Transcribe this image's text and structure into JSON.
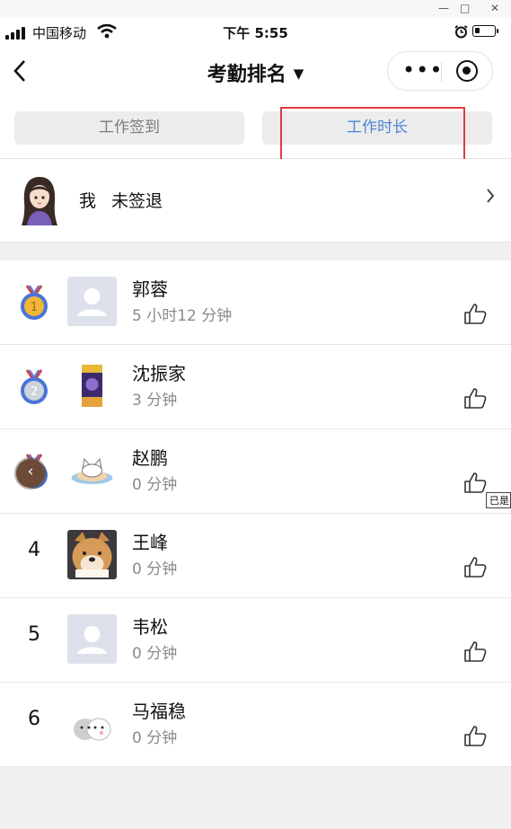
{
  "status_bar": {
    "carrier": "中国移动",
    "time": "下午 5:55"
  },
  "nav": {
    "title": "考勤排名"
  },
  "tabs": [
    {
      "label": "工作签到"
    },
    {
      "label": "工作时长"
    }
  ],
  "me": {
    "label": "我",
    "status": "未签退"
  },
  "list": [
    {
      "rank": "1",
      "name": "郭蓉",
      "duration": "5 小时12 分钟"
    },
    {
      "rank": "2",
      "name": "沈振家",
      "duration": "3 分钟"
    },
    {
      "rank": "3",
      "name": "赵鹏",
      "duration": "0 分钟"
    },
    {
      "rank": "4",
      "name": "王峰",
      "duration": "0 分钟"
    },
    {
      "rank": "5",
      "name": "韦松",
      "duration": "0 分钟"
    },
    {
      "rank": "6",
      "name": "马福稳",
      "duration": "0 分钟"
    }
  ],
  "tooltip": "已是",
  "colors": {
    "accent": "#4a86d6",
    "highlight": "#e23c3c"
  }
}
